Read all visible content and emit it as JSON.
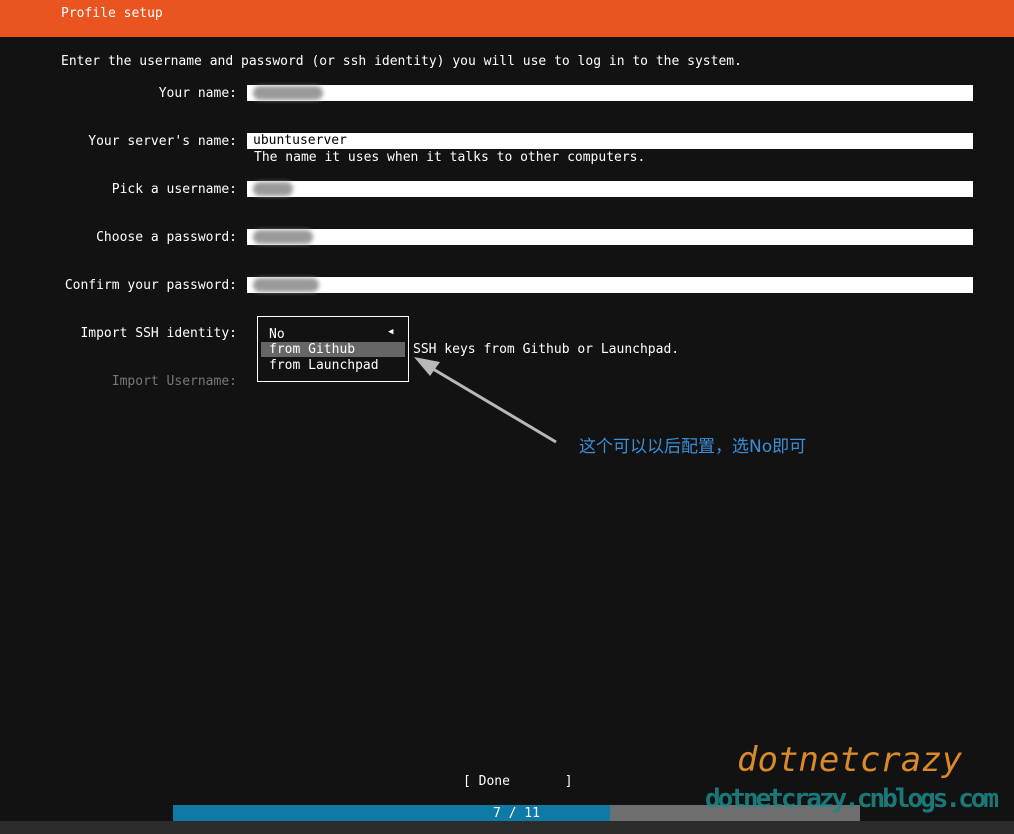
{
  "header": {
    "title": "Profile setup"
  },
  "intro": "Enter the username and password (or ssh identity) you will use to log in to the system.",
  "fields": [
    {
      "label": "Your name:",
      "value": ""
    },
    {
      "label": "Your server's name:",
      "value": "ubuntuserver",
      "help": "The name it uses when it talks to other computers."
    },
    {
      "label": "Pick a username:",
      "value": ""
    },
    {
      "label": "Choose a password:",
      "value": ""
    },
    {
      "label": "Confirm your password:",
      "value": ""
    }
  ],
  "ssh": {
    "label": "Import SSH identity:",
    "options": [
      "No",
      "from Github",
      "from Launchpad"
    ],
    "highlighted": "from Github",
    "help": "SSH keys from Github or Launchpad.",
    "import_username_label": "Import Username:"
  },
  "annotation": "这个可以以后配置，选No即可",
  "done_label": "[ Done       ]",
  "progress": {
    "text": "7 / 11",
    "fraction": 0.636
  },
  "watermark": {
    "line1": "dotnetcrazy",
    "line2": "dotnetcrazy.cnblogs.com"
  },
  "colors": {
    "header": "#e95420",
    "progress": "#0e7aa6"
  }
}
